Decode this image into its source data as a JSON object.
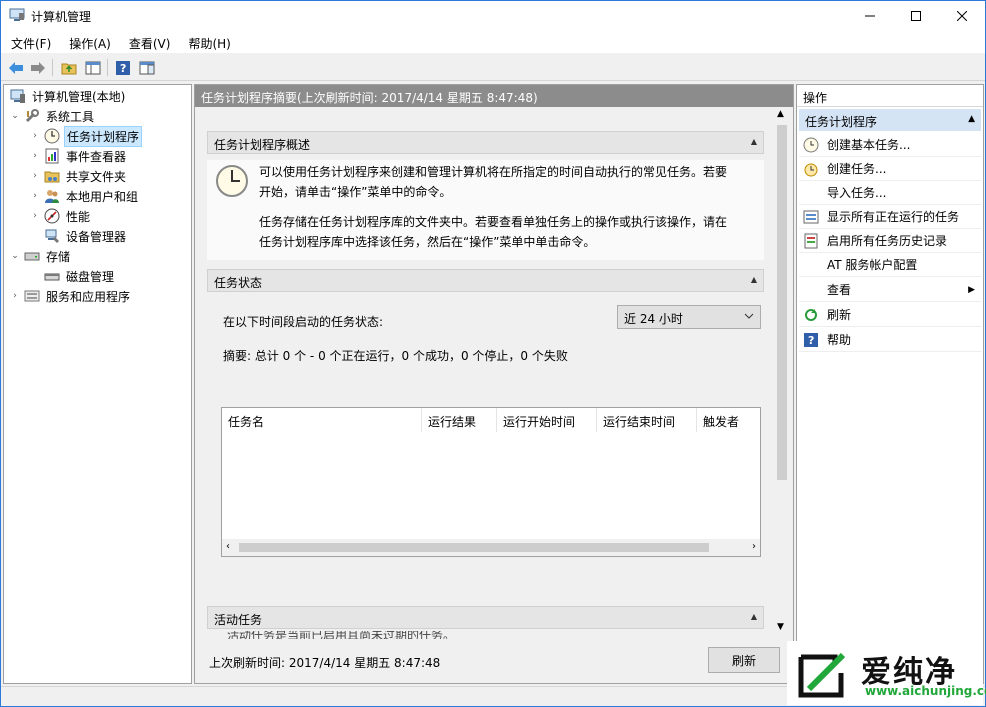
{
  "window": {
    "title": "计算机管理"
  },
  "menu": [
    "文件(F)",
    "操作(A)",
    "查看(V)",
    "帮助(H)"
  ],
  "tree": {
    "root": "计算机管理(本地)",
    "system_tools": "系统工具",
    "task_scheduler": "任务计划程序",
    "event_viewer": "事件查看器",
    "shared_folders": "共享文件夹",
    "local_users": "本地用户和组",
    "performance": "性能",
    "device_manager": "设备管理器",
    "storage": "存储",
    "disk_management": "磁盘管理",
    "services_apps": "服务和应用程序"
  },
  "center": {
    "header": "任务计划程序摘要(上次刷新时间: 2017/4/14 星期五 8:47:48)",
    "overview_title": "任务计划程序概述",
    "overview_p1": "可以使用任务计划程序来创建和管理计算机将在所指定的时间自动执行的常见任务。若要开始，请单击“操作”菜单中的命令。",
    "overview_p2": "任务存储在任务计划程序库的文件夹中。若要查看单独任务上的操作或执行该操作，请在任务计划程序库中选择该任务，然后在“操作”菜单中单击命令。",
    "status_title": "任务状态",
    "status_label": "在以下时间段启动的任务状态:",
    "period_selected": "近 24 小时",
    "summary": "摘要: 总计 0 个 - 0 个正在运行，0 个成功，0 个停止，0 个失败",
    "columns": [
      "任务名",
      "运行结果",
      "运行开始时间",
      "运行结束时间",
      "触发者"
    ],
    "active_title": "活动任务",
    "active_cut_text": "活动任务是当前已启用且尚未过期的任务。",
    "last_refresh": "上次刷新时间: 2017/4/14 星期五 8:47:48",
    "refresh_button": "刷新"
  },
  "actions": {
    "header": "操作",
    "group": "任务计划程序",
    "items": [
      {
        "label": "创建基本任务...",
        "icon": "create-basic-task-icon"
      },
      {
        "label": "创建任务...",
        "icon": "create-task-icon"
      },
      {
        "label": "导入任务...",
        "icon": ""
      },
      {
        "label": "显示所有正在运行的任务",
        "icon": "running-tasks-icon"
      },
      {
        "label": "启用所有任务历史记录",
        "icon": "history-icon"
      },
      {
        "label": "AT 服务帐户配置",
        "icon": ""
      },
      {
        "label": "查看",
        "icon": ""
      },
      {
        "label": "刷新",
        "icon": "refresh-icon"
      },
      {
        "label": "帮助",
        "icon": "help-icon"
      }
    ]
  },
  "watermark": {
    "brand": "爱纯净",
    "url": "www.aichunjing.com"
  },
  "colors": {
    "accent": "#2b79d8",
    "selection": "#cce8ff",
    "header_gray": "#8c8c8c",
    "group_blue": "#d4e4f5"
  }
}
